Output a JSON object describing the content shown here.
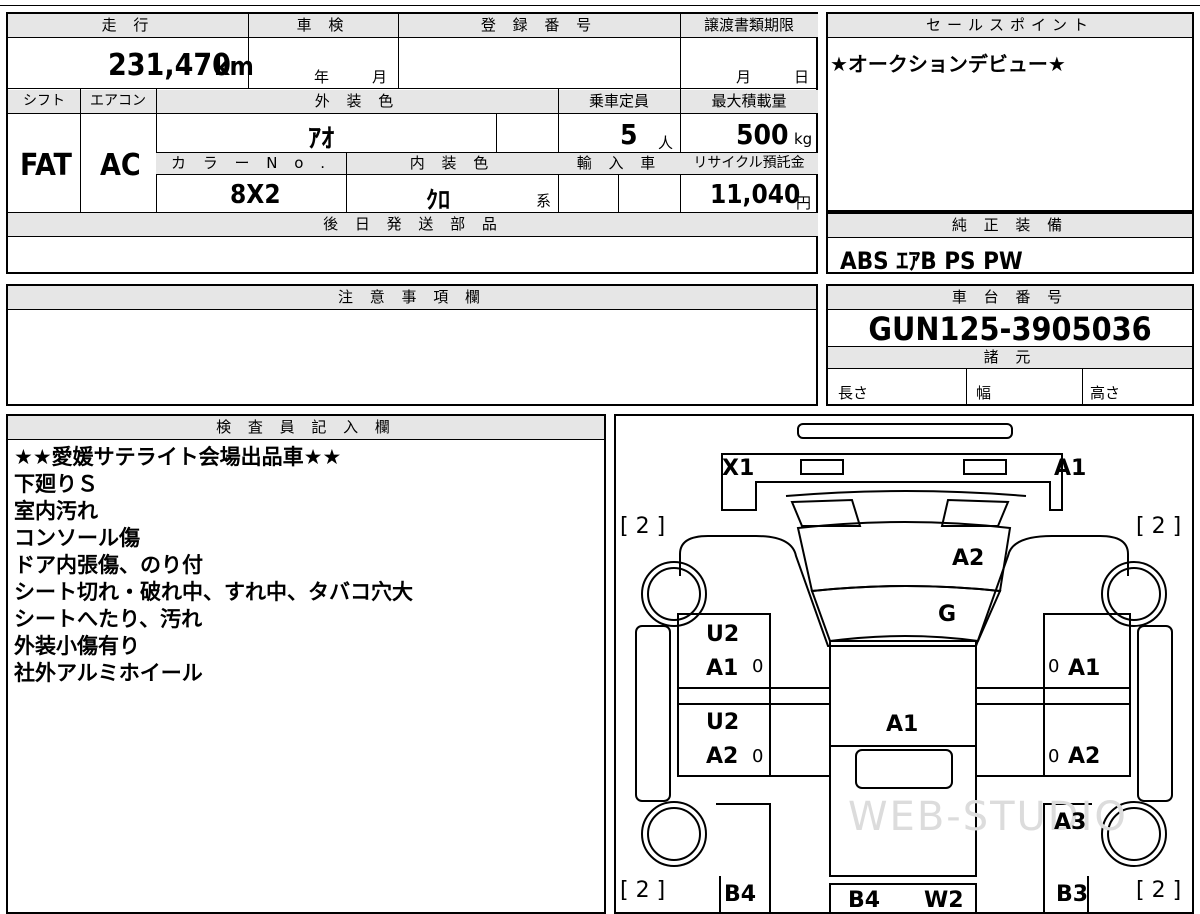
{
  "vehicle": {
    "mileage_label": "走 行",
    "mileage_value": "231,470",
    "mileage_unit": "km",
    "inspection_label": "車 検",
    "inspection_year_unit": "年",
    "inspection_month_unit": "月",
    "reg_number_label": "登 録 番 号",
    "deadline_label": "譲渡書類期限",
    "deadline_month_unit": "月",
    "deadline_day_unit": "日",
    "shift_label": "シフト",
    "shift_value": "FAT",
    "aircon_label": "エアコン",
    "aircon_value": "AC",
    "exterior_label": "外 装 色",
    "exterior_value": "ｱｵ",
    "capacity_label": "乗車定員",
    "capacity_value": "5",
    "capacity_unit": "人",
    "maxload_label": "最大積載量",
    "maxload_value": "500",
    "maxload_unit": "kg",
    "colorno_label": "カ ラ ー N o .",
    "colorno_value": "8X2",
    "interior_label": "内 装 色",
    "interior_value": "ｸﾛ",
    "interior_unit": "系",
    "import_label": "輸 入 車",
    "recycle_label": "リサイクル預託金",
    "recycle_value": "11,040",
    "recycle_unit": "円",
    "later_parts_label": "後 日 発 送 部 品"
  },
  "sales": {
    "label": "セールスポイント",
    "text": "★オークションデビュー★"
  },
  "equipment": {
    "label": "純 正 装 備",
    "text": "ABS ｴｱB PS PW"
  },
  "notes": {
    "label": "注 意 事 項 欄"
  },
  "chassis": {
    "label": "車 台 番 号",
    "value": "GUN125-3905036",
    "specs_label": "諸 元",
    "length_label": "長さ",
    "width_label": "幅",
    "height_label": "高さ"
  },
  "inspector": {
    "label": "検 査 員 記 入 欄",
    "lines": [
      "★★愛媛サテライト会場出品車★★",
      "下廻りＳ",
      "室内汚れ",
      "コンソール傷",
      "ドア内張傷、のり付",
      "シート切れ・破れ中、すれ中、タバコ穴大",
      "シートへたり、汚れ",
      "外装小傷有り",
      "社外アルミホイール"
    ]
  },
  "diagram": {
    "watermark": "WEB-STUDIO",
    "marks": {
      "front_left": "X1",
      "front_right": "A1",
      "tire_fl": "[ 2 ]",
      "tire_fr": "[ 2 ]",
      "tire_rl": "[ 2 ]",
      "tire_rr": "[ 2 ]",
      "hood": "A2",
      "windshield": "G",
      "roof": "A1",
      "front_door_left_1": "U2",
      "front_door_left_2": "A1",
      "rear_door_left_1": "U2",
      "rear_door_left_2": "A2",
      "front_door_right": "A1",
      "rear_door_right": "A2",
      "rear_fender_right": "A3",
      "rear_left": "B4",
      "rear_center_1": "B4",
      "rear_center_2": "W2",
      "rear_right": "B3",
      "zero_lf": "0",
      "zero_lr": "0",
      "zero_rf": "0",
      "zero_rr": "0"
    }
  }
}
